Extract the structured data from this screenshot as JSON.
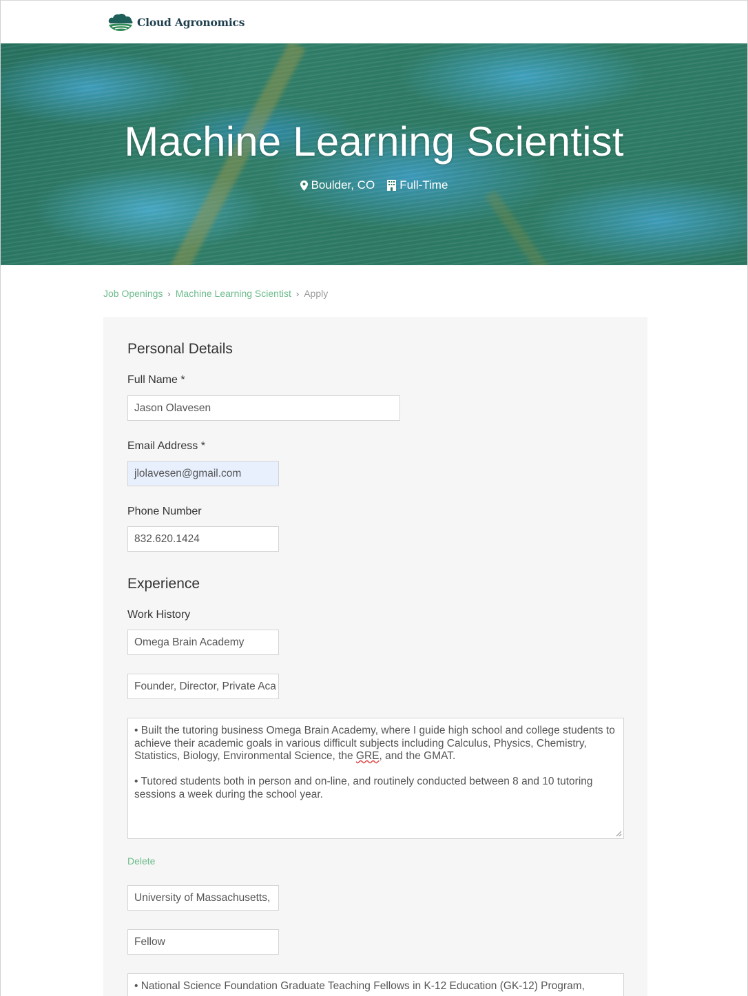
{
  "brand": {
    "name": "Cloud Agronomics",
    "logo_color": "#1f5f5a"
  },
  "hero": {
    "title": "Machine Learning Scientist",
    "location": "Boulder, CO",
    "location_icon": "map-pin-icon",
    "type": "Full-Time",
    "type_icon": "building-icon"
  },
  "breadcrumb": {
    "items": [
      "Job Openings",
      "Machine Learning Scientist"
    ],
    "current": "Apply",
    "separator_icon": "chevron-right-icon"
  },
  "form": {
    "personal_details": {
      "title": "Personal Details",
      "full_name": {
        "label": "Full Name *",
        "value": "Jason Olavesen"
      },
      "email": {
        "label": "Email Address *",
        "value": "jlolavesen@gmail.com"
      },
      "phone": {
        "label": "Phone Number",
        "value": "832.620.1424"
      }
    },
    "experience": {
      "title": "Experience",
      "work_history_label": "Work History",
      "entries": [
        {
          "company": "Omega Brain Academy",
          "title": "Founder, Director, Private Aca",
          "description": [
            "•  Built the tutoring business Omega Brain Academy, where I guide high school and college students to achieve their academic goals in various difficult subjects including Calculus, Physics, Chemistry, Statistics, Biology, Environmental Science, the ",
            "GRE",
            ", and the GMAT.",
            "•  Tutored students both in person and on-line, and routinely conducted between 8 and 10 tutoring sessions a week during the school year."
          ],
          "delete_label": "Delete"
        },
        {
          "company": "University of Massachusetts,",
          "title": "Fellow",
          "description": [
            "•  National Science Foundation Graduate Teaching Fellows in K-12 Education (GK-12) Program,"
          ]
        }
      ]
    }
  },
  "colors": {
    "accent_green": "#6dbb8c",
    "autofill_blue": "#e8f0fe",
    "panel_bg": "#f5f6f5"
  }
}
